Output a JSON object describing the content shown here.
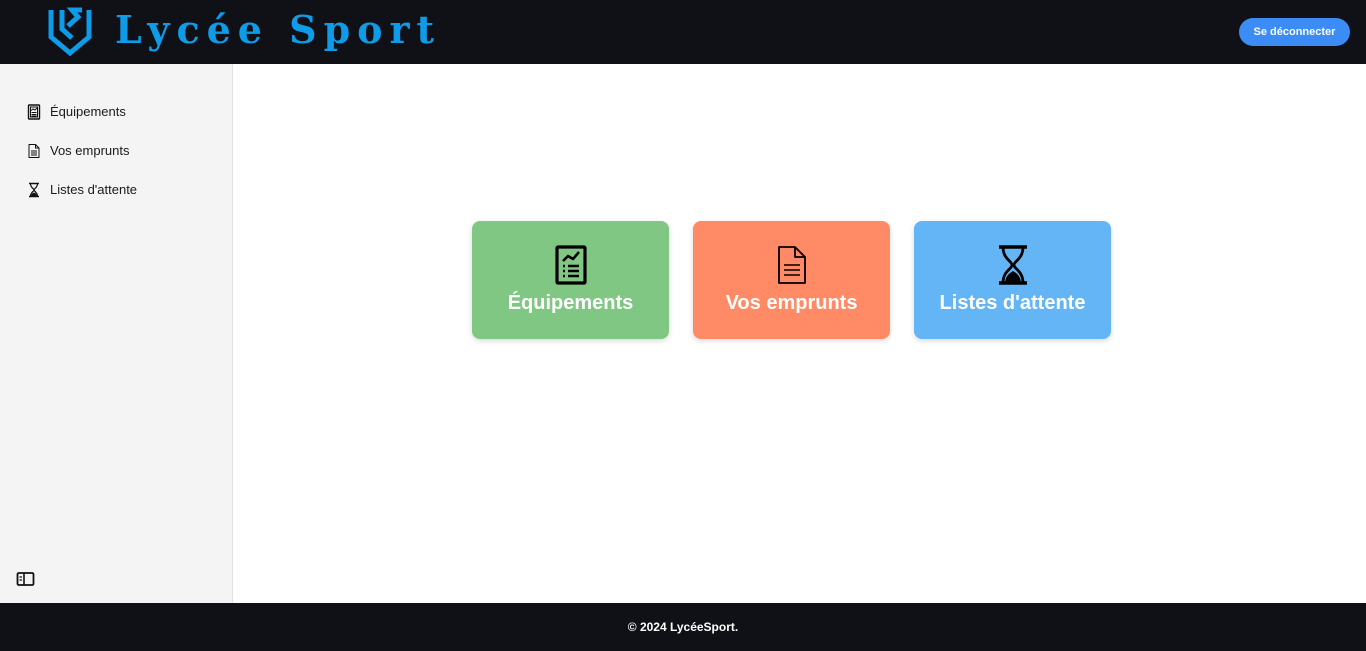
{
  "header": {
    "brand": "Lycée Sport",
    "logout_label": "Se déconnecter"
  },
  "sidebar": {
    "items": [
      {
        "label": "Équipements",
        "icon": "report-icon"
      },
      {
        "label": "Vos emprunts",
        "icon": "document-icon"
      },
      {
        "label": "Listes d'attente",
        "icon": "hourglass-icon"
      }
    ],
    "toggle_icon": "sidebar-toggle-icon"
  },
  "cards": [
    {
      "label": "Équipements",
      "icon": "report-icon",
      "color": "#81c784"
    },
    {
      "label": "Vos emprunts",
      "icon": "document-icon",
      "color": "#ff8a65"
    },
    {
      "label": "Listes d'attente",
      "icon": "hourglass-icon",
      "color": "#64b5f6"
    }
  ],
  "footer": {
    "copyright": "© 2024 LycéeSport."
  },
  "colors": {
    "header_bg": "#0f1116",
    "brand": "#0e9be8",
    "logout_button": "#3b8cf5",
    "sidebar_bg": "#f4f4f5"
  }
}
